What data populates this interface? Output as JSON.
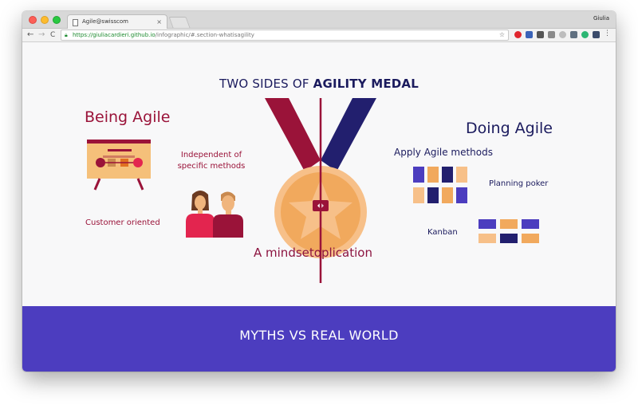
{
  "browser": {
    "tab_title": "Agile@swisscom",
    "tab_close": "×",
    "user_name": "Giulia",
    "url_host": "https://giuliacardieri.github.io",
    "url_path": "/infographic/#.section-whatisagility",
    "back": "←",
    "forward": "→",
    "reload": "C",
    "bookmark_star": "☆",
    "menu": "⋮"
  },
  "section": {
    "title_prefix": "TWO SIDES OF ",
    "title_bold": "AGILITY MEDAL"
  },
  "being": {
    "heading": "Being Agile",
    "independent": "Independent of specific methods",
    "customer": "Customer oriented"
  },
  "doing": {
    "heading": "Doing Agile",
    "apply": "Apply Agile methods",
    "planning_poker": "Planning poker",
    "kanban": "Kanban"
  },
  "medal": {
    "caption": "A mindsetoplication"
  },
  "footer_section": {
    "title": "MYTHS VS REAL WORLD"
  },
  "colors": {
    "crimson": "#9a1339",
    "navy": "#1b1b5e",
    "orange": "#f1a95d",
    "purple": "#4c3dbf"
  }
}
